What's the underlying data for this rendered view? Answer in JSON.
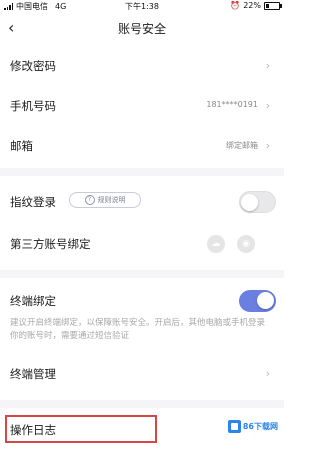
{
  "status_bar": {
    "carrier": "中国电信",
    "network": "4G",
    "time": "下午1:38",
    "battery": "22%",
    "battery_level": 0.22
  },
  "nav": {
    "back_icon": "chevron-left-icon",
    "title": "账号安全"
  },
  "rows": {
    "change_password": {
      "label": "修改密码"
    },
    "phone": {
      "label": "手机号码",
      "value": "181****0191"
    },
    "email": {
      "label": "邮箱",
      "value": "绑定邮箱"
    },
    "fingerprint": {
      "label": "指纹登录",
      "help_label": "规则说明",
      "enabled": false
    },
    "third_party": {
      "label": "第三方账号绑定"
    },
    "device_binding": {
      "label": "终端绑定",
      "enabled": true,
      "description": "建议开启终端绑定，以保障账号安全。开启后，其他电脑或手机登录你的账号时，需要通过短信验证"
    },
    "device_management": {
      "label": "终端管理"
    },
    "operation_log": {
      "label": "操作日志"
    }
  },
  "watermark": {
    "text": "86下载网"
  },
  "colors": {
    "toggle_on": "#6a7fe0",
    "toggle_off": "#e8e8ea",
    "highlight": "#d84545",
    "section_gap": "#f5f5f7"
  }
}
